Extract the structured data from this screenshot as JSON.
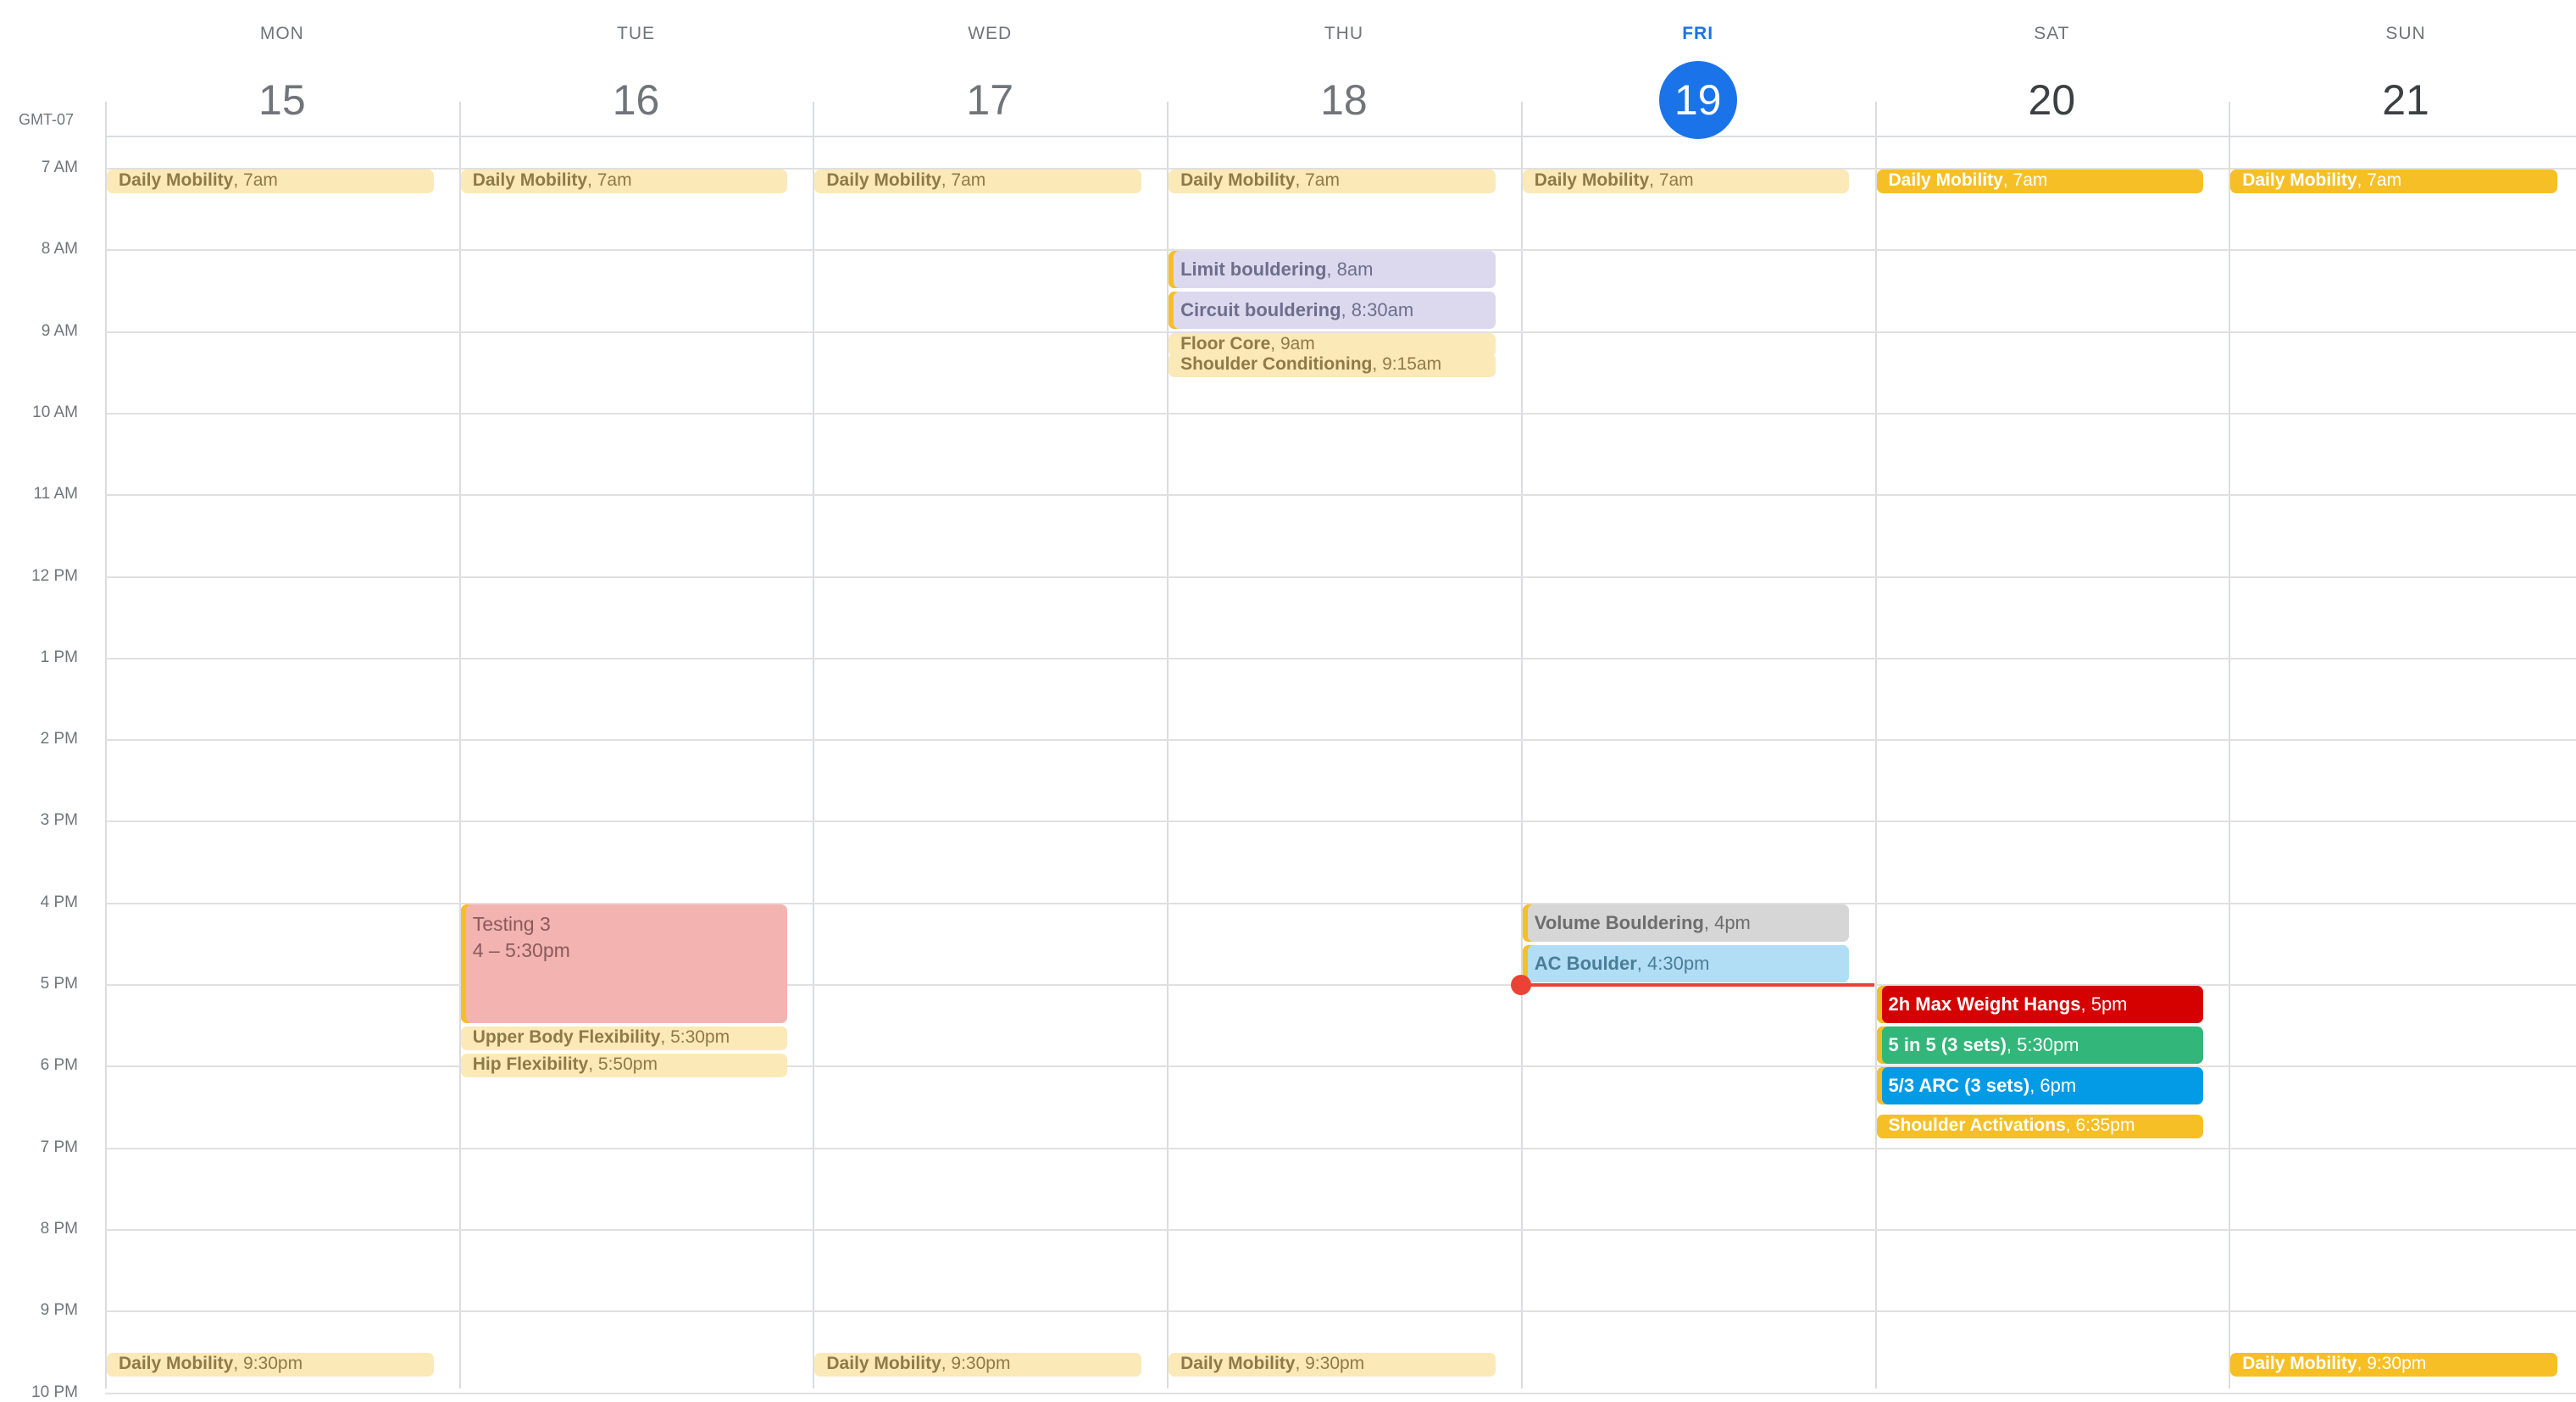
{
  "timezone": "GMT-07",
  "days": [
    {
      "dow": "MON",
      "num": "15",
      "state": "past"
    },
    {
      "dow": "TUE",
      "num": "16",
      "state": "past"
    },
    {
      "dow": "WED",
      "num": "17",
      "state": "past"
    },
    {
      "dow": "THU",
      "num": "18",
      "state": "past"
    },
    {
      "dow": "FRI",
      "num": "19",
      "state": "today"
    },
    {
      "dow": "SAT",
      "num": "20",
      "state": "future"
    },
    {
      "dow": "SUN",
      "num": "21",
      "state": "future"
    }
  ],
  "hours": [
    "7 AM",
    "8 AM",
    "9 AM",
    "10 AM",
    "11 AM",
    "12 PM",
    "1 PM",
    "2 PM",
    "3 PM",
    "4 PM",
    "5 PM",
    "6 PM",
    "7 PM",
    "8 PM",
    "9 PM",
    "10 PM"
  ],
  "colors": {
    "today": "#1a73e8",
    "now_indicator": "#ea4335",
    "banana": "#f6bf26",
    "tomato": "#d50000",
    "basil": "#33b679",
    "peacock": "#039be5",
    "lavender": "#7986cb",
    "graphite": "#616161",
    "flamingo": "#e67c73"
  },
  "events": [
    {
      "day": 0,
      "title": "Daily Mobility",
      "time": "7am",
      "color": "c-yellow-light"
    },
    {
      "day": 1,
      "title": "Daily Mobility",
      "time": "7am",
      "color": "c-yellow-light"
    },
    {
      "day": 2,
      "title": "Daily Mobility",
      "time": "7am",
      "color": "c-yellow-light"
    },
    {
      "day": 3,
      "title": "Daily Mobility",
      "time": "7am",
      "color": "c-yellow-light"
    },
    {
      "day": 4,
      "title": "Daily Mobility",
      "time": "7am",
      "color": "c-yellow-light"
    },
    {
      "day": 5,
      "title": "Daily Mobility",
      "time": "7am",
      "color": "c-yellow"
    },
    {
      "day": 6,
      "title": "Daily Mobility",
      "time": "7am",
      "color": "c-yellow"
    },
    {
      "day": 3,
      "title": "Limit bouldering",
      "time": "8am",
      "color": "c-lavender"
    },
    {
      "day": 3,
      "title": "Circuit bouldering",
      "time": "8:30am",
      "color": "c-lavender"
    },
    {
      "day": 3,
      "title": "Floor Core",
      "time": "9am",
      "color": "c-yellow-light"
    },
    {
      "day": 3,
      "title": "Shoulder Conditioning",
      "time": "9:15am",
      "color": "c-yellow-light"
    },
    {
      "day": 1,
      "title": "Testing 3",
      "time": "4 – 5:30pm",
      "color": "c-pink"
    },
    {
      "day": 1,
      "title": "Upper Body Flexibility",
      "time": "5:30pm",
      "color": "c-yellow-light"
    },
    {
      "day": 1,
      "title": "Hip Flexibility",
      "time": "5:50pm",
      "color": "c-yellow-light"
    },
    {
      "day": 4,
      "title": "Volume Bouldering",
      "time": "4pm",
      "color": "c-grey"
    },
    {
      "day": 4,
      "title": "AC Boulder",
      "time": "4:30pm",
      "color": "c-blue-light"
    },
    {
      "day": 5,
      "title": "2h Max Weight Hangs",
      "time": "5pm",
      "color": "c-red"
    },
    {
      "day": 5,
      "title": "5 in 5 (3 sets)",
      "time": "5:30pm",
      "color": "c-green"
    },
    {
      "day": 5,
      "title": "5/3 ARC (3 sets)",
      "time": "6pm",
      "color": "c-blue"
    },
    {
      "day": 5,
      "title": "Shoulder Activations",
      "time": "6:35pm",
      "color": "c-yellow"
    },
    {
      "day": 0,
      "title": "Daily Mobility",
      "time": "9:30pm",
      "color": "c-yellow-light"
    },
    {
      "day": 2,
      "title": "Daily Mobility",
      "time": "9:30pm",
      "color": "c-yellow-light"
    },
    {
      "day": 3,
      "title": "Daily Mobility",
      "time": "9:30pm",
      "color": "c-yellow-light"
    },
    {
      "day": 6,
      "title": "Daily Mobility",
      "time": "9:30pm",
      "color": "c-yellow"
    }
  ],
  "now": {
    "day": 4,
    "time": "5:00pm"
  }
}
